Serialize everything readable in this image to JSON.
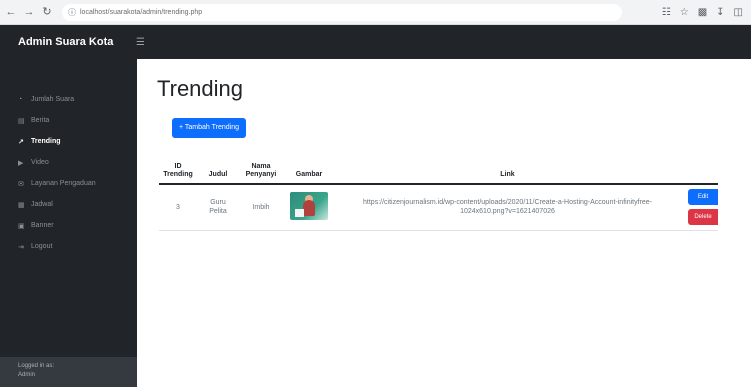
{
  "browser": {
    "back_icon": "arrow-left-icon",
    "forward_icon": "arrow-right-icon",
    "reload_icon": "reload-icon",
    "url": "localhost/suarakota/admin/trending.php",
    "toolbar_icons": [
      "translate-icon",
      "star-icon",
      "extension-icon",
      "download-icon",
      "more-icon"
    ]
  },
  "navbar": {
    "brand": "Admin Suara Kota",
    "toggle_icon": "menu-icon"
  },
  "sidebar": {
    "items": [
      {
        "label": "Jumlah Suara",
        "icon": "gauge-icon",
        "active": false
      },
      {
        "label": "Berita",
        "icon": "newspaper-icon",
        "active": false
      },
      {
        "label": "Trending",
        "icon": "trending-icon",
        "active": true
      },
      {
        "label": "Video",
        "icon": "video-icon",
        "active": false
      },
      {
        "label": "Layanan Pengaduan",
        "icon": "bullhorn-icon",
        "active": false
      },
      {
        "label": "Jadwal",
        "icon": "calendar-icon",
        "active": false
      },
      {
        "label": "Banner",
        "icon": "image-icon",
        "active": false
      },
      {
        "label": "Logout",
        "icon": "logout-icon",
        "active": false
      }
    ],
    "footer_line1": "Logged in as:",
    "footer_line2": "Admin"
  },
  "main": {
    "title": "Trending",
    "add_button": "+ Tambah Trending",
    "table": {
      "headers": [
        "ID Trending",
        "Judul",
        "Nama Penyanyi",
        "Gambar",
        "Link",
        ""
      ],
      "rows": [
        {
          "id": "3",
          "judul": "Guru Pelita",
          "penyanyi": "Imbih",
          "gambar_icon": "thumbnail-image",
          "link": "https://citizenjournalism.id/wp-content/uploads/2020/11/Create-a-Hosting-Account-infinityfree-1024x610.png?v=1621407026",
          "edit_label": "Edit",
          "delete_label": "Delete"
        }
      ]
    }
  },
  "colors": {
    "sidebar_bg": "#212529",
    "primary": "#0d6efd",
    "danger": "#dc3545"
  }
}
